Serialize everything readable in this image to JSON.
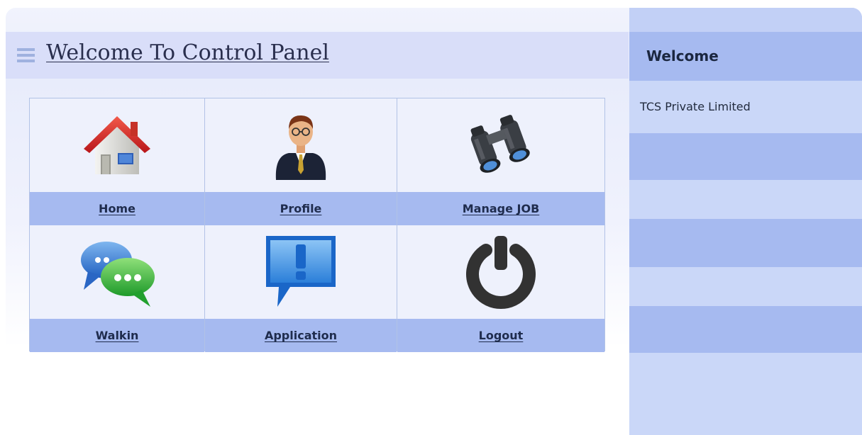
{
  "panel": {
    "title": "Welcome To Control Panel"
  },
  "tiles": [
    {
      "label": "Home",
      "icon": "house-icon"
    },
    {
      "label": "Profile",
      "icon": "businessman-icon"
    },
    {
      "label": "Manage JOB",
      "icon": "binoculars-icon"
    },
    {
      "label": "Walkin",
      "icon": "chat-bubbles-icon"
    },
    {
      "label": "Application",
      "icon": "exclamation-bubble-icon"
    },
    {
      "label": "Logout",
      "icon": "power-icon"
    }
  ],
  "sidebar": {
    "title": "Welcome",
    "company": "TCS Private Limited"
  },
  "colors": {
    "header_band": "#d9def9",
    "label_bar": "#a6baf0",
    "sidebar_light": "#cad7f8",
    "sidebar_dark": "#a6baf0"
  }
}
